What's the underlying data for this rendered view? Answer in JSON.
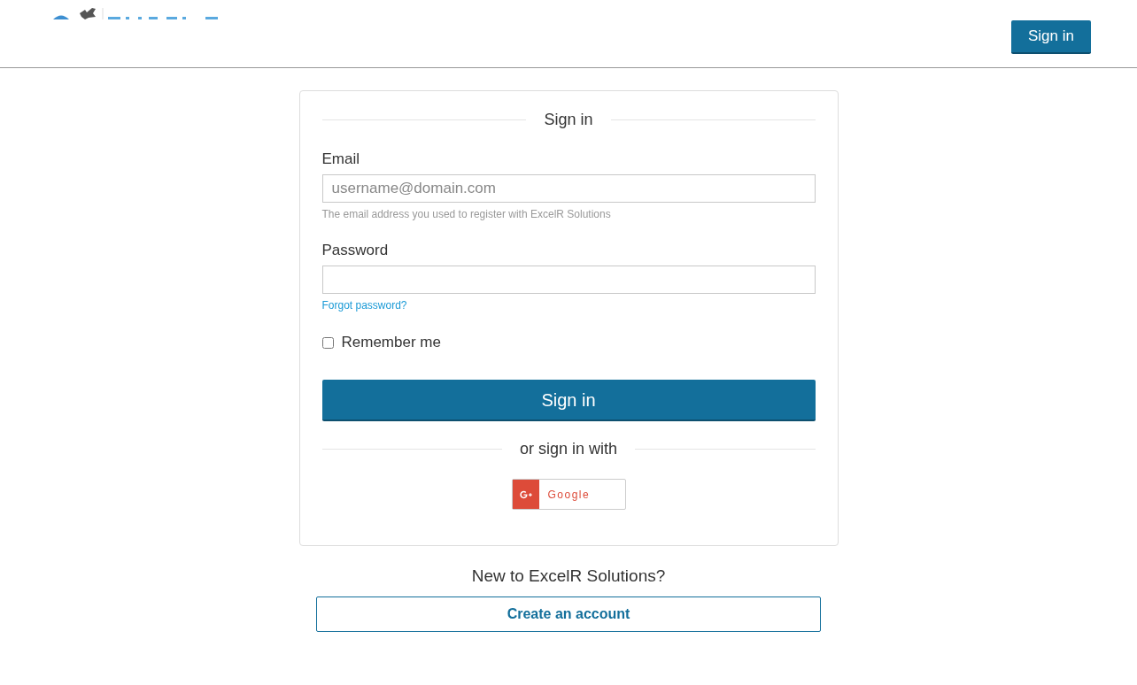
{
  "header": {
    "sign_in_button": "Sign in"
  },
  "form": {
    "title": "Sign in",
    "fields": [
      {
        "label": "Email",
        "placeholder": "username@domain.com",
        "help": "The email address you used to register with ExcelR Solutions"
      },
      {
        "label": "Password",
        "link": "Forgot password?"
      }
    ],
    "remember": {
      "label": "Remember me",
      "checked": false
    },
    "submit": "Sign in",
    "divider": "or sign in with",
    "social": [
      {
        "label": "Google"
      }
    ]
  },
  "footer": {
    "prompt": "New to ExcelR Solutions?",
    "create_button": "Create an account"
  }
}
